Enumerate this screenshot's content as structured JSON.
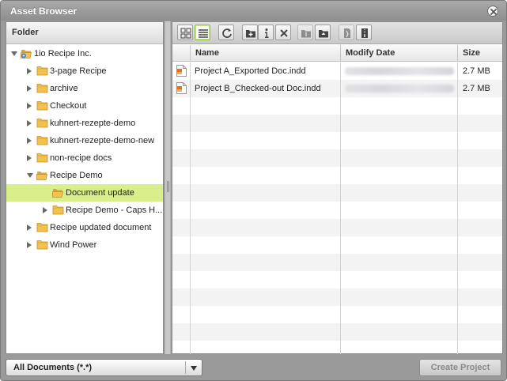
{
  "window": {
    "title": "Asset Browser"
  },
  "left_pane": {
    "header": "Folder",
    "tree": [
      {
        "label": "1io Recipe Inc.",
        "level": 0,
        "expanded": true,
        "has_children": true,
        "root": true,
        "selected": false
      },
      {
        "label": "3-page Recipe",
        "level": 1,
        "expanded": false,
        "has_children": true,
        "selected": false
      },
      {
        "label": "archive",
        "level": 1,
        "expanded": false,
        "has_children": true,
        "selected": false
      },
      {
        "label": "Checkout",
        "level": 1,
        "expanded": false,
        "has_children": true,
        "selected": false
      },
      {
        "label": "kuhnert-rezepte-demo",
        "level": 1,
        "expanded": false,
        "has_children": true,
        "selected": false
      },
      {
        "label": "kuhnert-rezepte-demo-new",
        "level": 1,
        "expanded": false,
        "has_children": true,
        "selected": false
      },
      {
        "label": "non-recipe docs",
        "level": 1,
        "expanded": false,
        "has_children": true,
        "selected": false
      },
      {
        "label": "Recipe Demo",
        "level": 1,
        "expanded": true,
        "has_children": true,
        "selected": false
      },
      {
        "label": "Document update",
        "level": 2,
        "expanded": false,
        "has_children": false,
        "selected": true
      },
      {
        "label": "Recipe Demo - Caps H...",
        "level": 2,
        "expanded": false,
        "has_children": true,
        "selected": false
      },
      {
        "label": "Recipe updated document",
        "level": 1,
        "expanded": false,
        "has_children": true,
        "selected": false
      },
      {
        "label": "Wind Power",
        "level": 1,
        "expanded": false,
        "has_children": true,
        "selected": false
      }
    ]
  },
  "toolbar": {
    "buttons": [
      {
        "name": "thumbnail-view-button",
        "icon": "grid-icon",
        "active": false,
        "disabled": false
      },
      {
        "name": "list-view-button",
        "icon": "list-icon",
        "active": true,
        "disabled": false
      },
      {
        "name": "refresh-button",
        "icon": "refresh-icon",
        "active": false,
        "disabled": false
      },
      {
        "name": "new-folder-button",
        "icon": "folder-add-icon",
        "active": false,
        "disabled": false
      },
      {
        "name": "info-button",
        "icon": "info-icon",
        "active": false,
        "disabled": false
      },
      {
        "name": "delete-button",
        "icon": "close-icon",
        "active": false,
        "disabled": false
      },
      {
        "name": "move-folder-button",
        "icon": "folder-icon",
        "active": false,
        "disabled": true
      },
      {
        "name": "upload-button",
        "icon": "upload-icon",
        "active": false,
        "disabled": false
      },
      {
        "name": "checkout-button",
        "icon": "checkout-icon",
        "active": false,
        "disabled": true
      },
      {
        "name": "zip-button",
        "icon": "zip-icon",
        "active": false,
        "disabled": false
      }
    ]
  },
  "table": {
    "columns": [
      {
        "label": "Name"
      },
      {
        "label": "Modify Date"
      },
      {
        "label": "Size"
      }
    ],
    "rows": [
      {
        "name": "Project A_Exported Doc.indd",
        "modify_date": "",
        "size": "2.7 MB"
      },
      {
        "name": "Project B_Checked-out Doc.indd",
        "modify_date": "",
        "size": "2.7 MB"
      }
    ]
  },
  "footer": {
    "filter_value": "All Documents (*.*)",
    "create_label": "Create Project"
  },
  "colors": {
    "selection": "#d8ef8c",
    "folder": "#f2c24e",
    "accent_green": "#8cc63f"
  }
}
